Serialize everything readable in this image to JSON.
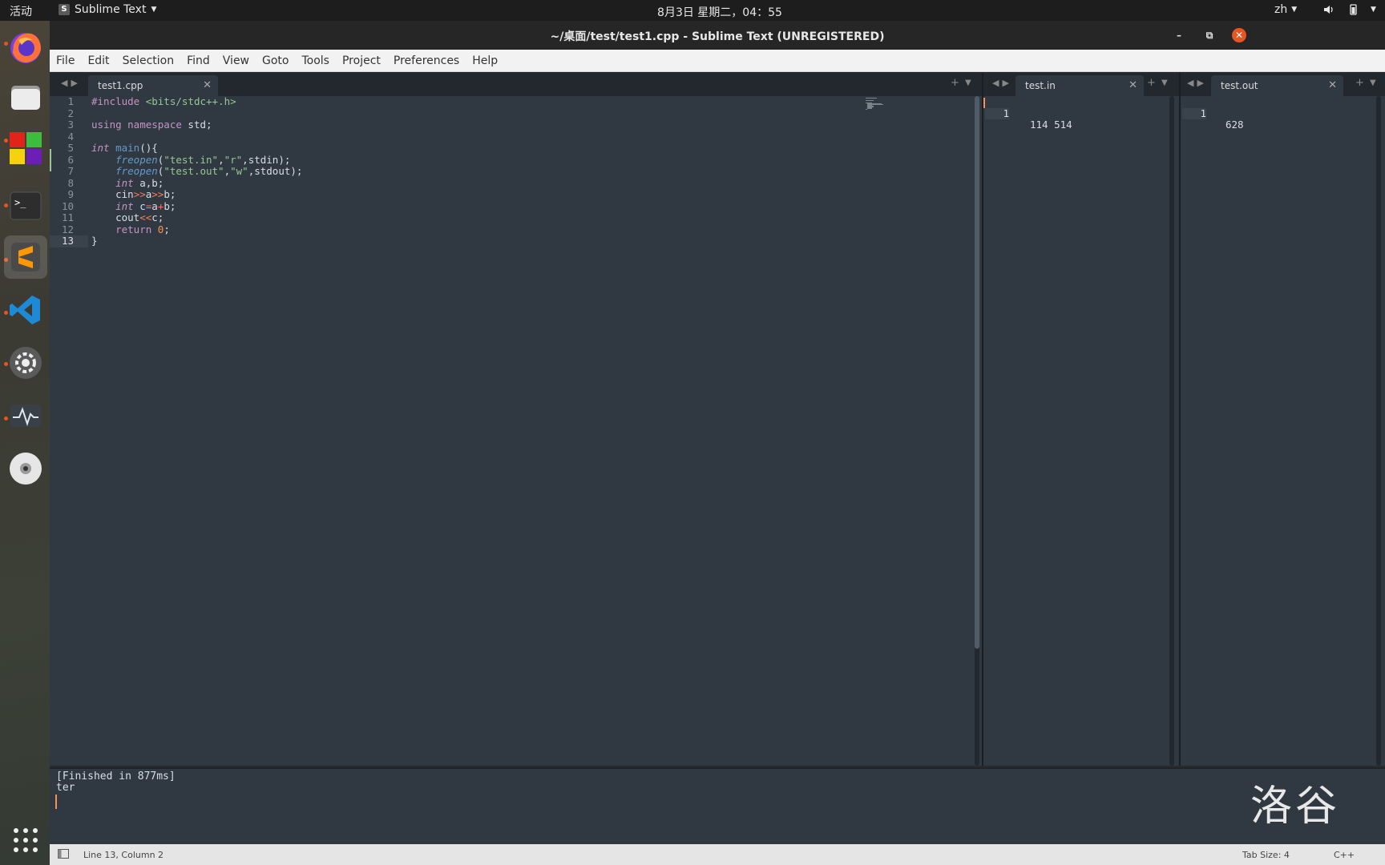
{
  "topbar": {
    "activities": "活动",
    "app_menu": "Sublime Text",
    "clock": "8月3日 星期二，04：55",
    "lang": "zh"
  },
  "dock": {
    "items": [
      "firefox-icon",
      "files-icon",
      "software-center-icon",
      "terminal-icon",
      "sublime-text-icon",
      "vscode-icon",
      "settings-icon",
      "system-monitor-icon",
      "dvd-icon",
      "show-apps-icon"
    ]
  },
  "window": {
    "title": "~/桌面/test/test1.cpp - Sublime Text (UNREGISTERED)"
  },
  "menu": [
    "File",
    "Edit",
    "Selection",
    "Find",
    "View",
    "Goto",
    "Tools",
    "Project",
    "Preferences",
    "Help"
  ],
  "groups": {
    "main": {
      "tab": "test1.cpp",
      "line_numbers": [
        "1",
        "2",
        "3",
        "4",
        "5",
        "6",
        "7",
        "8",
        "9",
        "10",
        "11",
        "12",
        "13"
      ],
      "current_line": "13"
    },
    "input": {
      "tab": "test.in",
      "line_numbers": [
        "1"
      ],
      "lines": [
        "114 514"
      ]
    },
    "output_file": {
      "tab": "test.out",
      "line_numbers": [
        "1"
      ],
      "lines": [
        "628"
      ]
    }
  },
  "code_lines": [
    [
      {
        "t": "#include ",
        "c": "pre"
      },
      {
        "t": "<bits/stdc++.h>",
        "c": "str"
      }
    ],
    [],
    [
      {
        "t": "using ",
        "c": "kw"
      },
      {
        "t": "namespace ",
        "c": "kw"
      },
      {
        "t": "std;",
        "c": ""
      }
    ],
    [],
    [
      {
        "t": "int ",
        "c": "it"
      },
      {
        "t": "main",
        "c": "fnp"
      },
      {
        "t": "(){",
        "c": ""
      }
    ],
    [
      {
        "t": "    ",
        "c": ""
      },
      {
        "t": "freopen",
        "c": "fn"
      },
      {
        "t": "(",
        "c": ""
      },
      {
        "t": "\"test.in\"",
        "c": "str"
      },
      {
        "t": ",",
        "c": ""
      },
      {
        "t": "\"r\"",
        "c": "str"
      },
      {
        "t": ",stdin);",
        "c": ""
      }
    ],
    [
      {
        "t": "    ",
        "c": ""
      },
      {
        "t": "freopen",
        "c": "fn"
      },
      {
        "t": "(",
        "c": ""
      },
      {
        "t": "\"test.out\"",
        "c": "str"
      },
      {
        "t": ",",
        "c": ""
      },
      {
        "t": "\"w\"",
        "c": "str"
      },
      {
        "t": ",stdout);",
        "c": ""
      }
    ],
    [
      {
        "t": "    ",
        "c": ""
      },
      {
        "t": "int ",
        "c": "it"
      },
      {
        "t": "a,b;",
        "c": ""
      }
    ],
    [
      {
        "t": "    cin",
        "c": ""
      },
      {
        "t": ">>",
        "c": "op"
      },
      {
        "t": "a",
        "c": ""
      },
      {
        "t": ">>",
        "c": "op"
      },
      {
        "t": "b;",
        "c": ""
      }
    ],
    [
      {
        "t": "    ",
        "c": ""
      },
      {
        "t": "int ",
        "c": "it"
      },
      {
        "t": "c",
        "c": ""
      },
      {
        "t": "=",
        "c": "op"
      },
      {
        "t": "a",
        "c": ""
      },
      {
        "t": "+",
        "c": "op"
      },
      {
        "t": "b;",
        "c": ""
      }
    ],
    [
      {
        "t": "    cout",
        "c": ""
      },
      {
        "t": "<<",
        "c": "op"
      },
      {
        "t": "c;",
        "c": ""
      }
    ],
    [
      {
        "t": "    ",
        "c": ""
      },
      {
        "t": "return ",
        "c": "kw"
      },
      {
        "t": "0",
        "c": "num"
      },
      {
        "t": ";",
        "c": ""
      }
    ],
    [
      {
        "t": "}",
        "c": ""
      }
    ]
  ],
  "output_panel": {
    "lines": [
      "[Finished in 877ms]",
      "ter"
    ]
  },
  "watermark": "洛谷",
  "status": {
    "position": "Line 13, Column 2",
    "tab_size": "Tab Size: 4",
    "syntax": "C++"
  },
  "colors": {
    "accent": "#e95420",
    "editor_bg": "#303841",
    "tabbar_bg": "#23282e"
  }
}
